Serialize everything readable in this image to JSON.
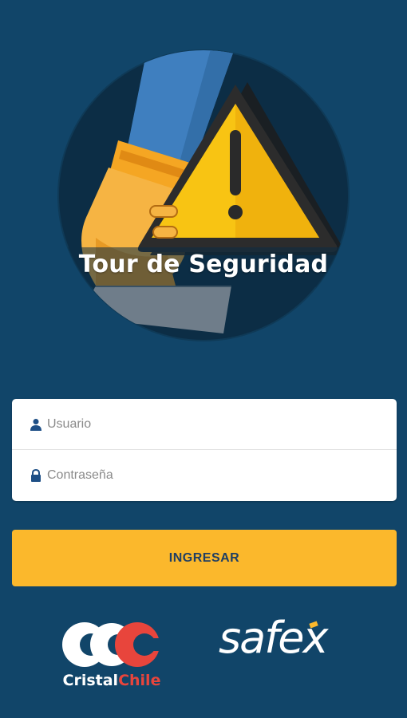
{
  "app": {
    "title": "Tour de Seguridad"
  },
  "login": {
    "username_placeholder": "Usuario",
    "password_placeholder": "Contraseña",
    "submit_label": "INGRESAR"
  },
  "footer": {
    "cristal_brand_part1": "Cristal",
    "cristal_brand_part2": "Chile",
    "safex_brand": "safex"
  },
  "icons": {
    "logo": "warning-triangle-hand-icon",
    "user": "user-icon",
    "lock": "lock-icon"
  },
  "colors": {
    "background": "#114569",
    "accent": "#fbb82c",
    "button_text": "#1f3e63",
    "cristal_red": "#e8453c"
  }
}
